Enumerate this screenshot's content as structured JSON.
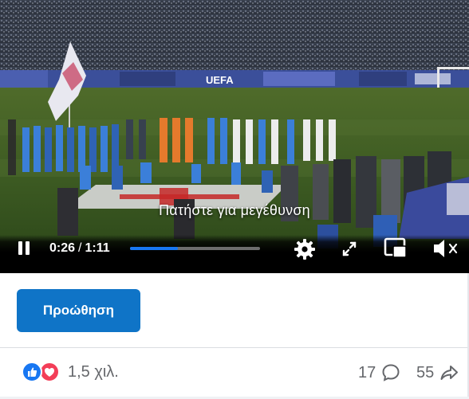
{
  "video": {
    "overlay_hint": "Πατήστε για μεγέθυνση",
    "current_time": "0:26",
    "separator": "/",
    "duration": "1:11",
    "progress_fraction": 0.3662,
    "sponsor_board_text": "UEFA",
    "controls": {
      "pause_icon": "pause-icon",
      "settings_icon": "gear-icon",
      "fullscreen_icon": "expand-icon",
      "pip_icon": "picture-in-picture-icon",
      "volume_icon": "volume-icon"
    }
  },
  "actions": {
    "promote_label": "Προώθηση"
  },
  "stats": {
    "reactions_count": "1,5 χιλ.",
    "comments_count": "17",
    "shares_count": "55",
    "reaction_icons": [
      "like-icon",
      "love-icon"
    ]
  },
  "colors": {
    "accent": "#0f74c7",
    "progress": "#1877f2",
    "like": "#1877f2",
    "love": "#f33e58",
    "muted_text": "#65676b"
  }
}
